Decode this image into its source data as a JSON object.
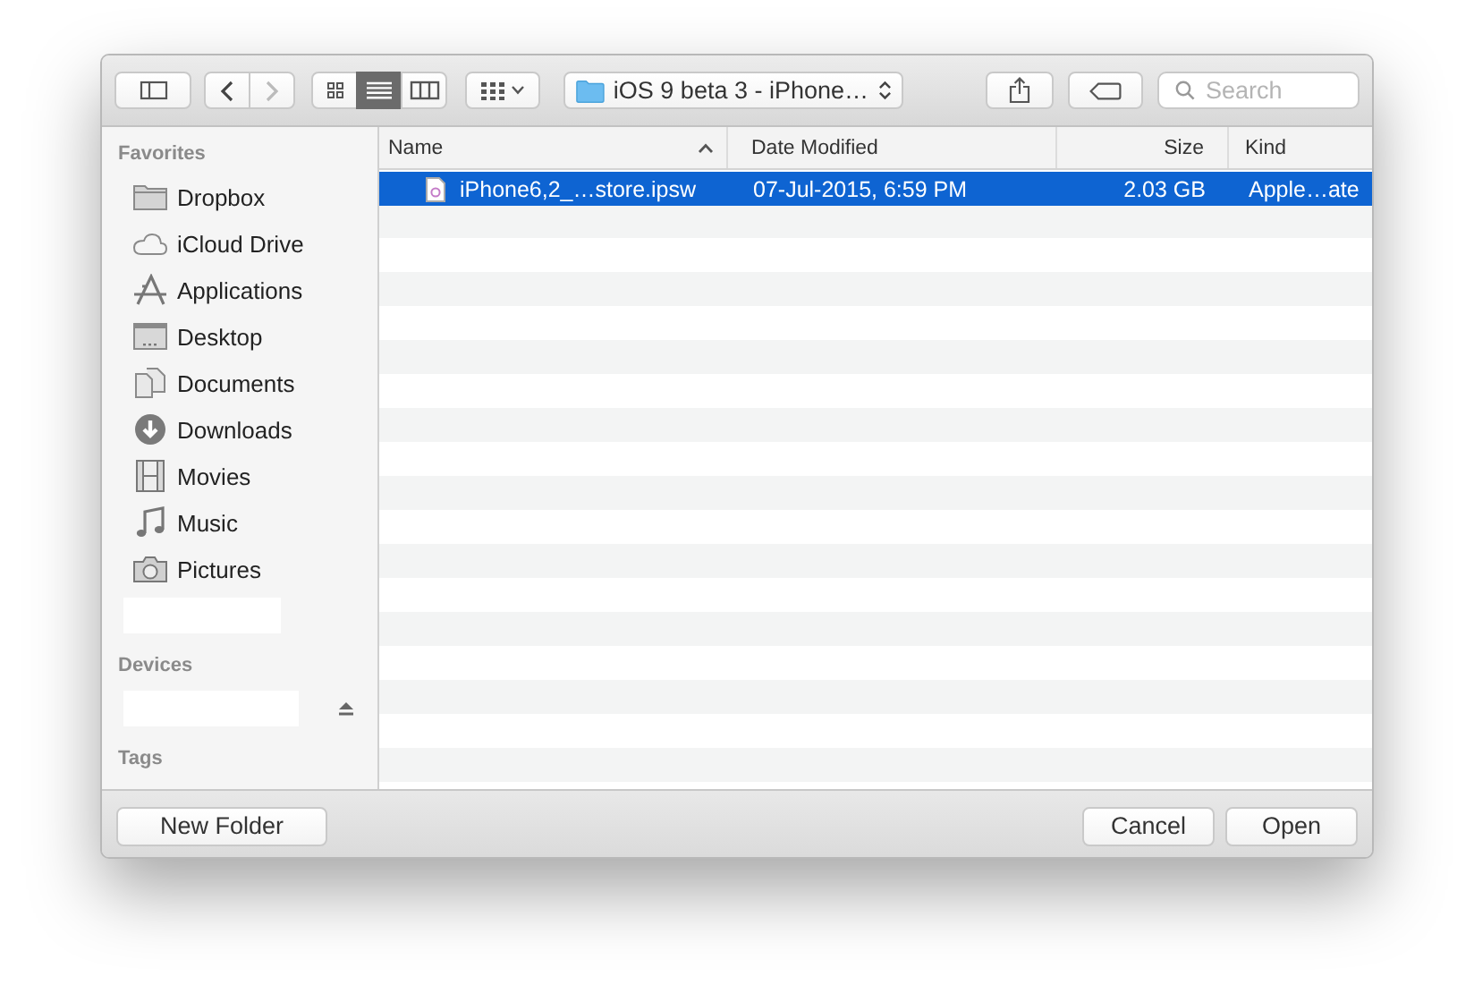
{
  "toolbar": {
    "view_modes": [
      {
        "selected": false
      },
      {
        "selected": true
      },
      {
        "selected": false
      }
    ],
    "location": "iOS 9 beta 3 - iPhone…",
    "search": {
      "placeholder": "Search"
    }
  },
  "sidebar": {
    "sections": [
      {
        "title": "Favorites",
        "items": [
          {
            "kind": "place",
            "label": "Dropbox"
          },
          {
            "kind": "place",
            "label": "iCloud Drive"
          },
          {
            "kind": "place",
            "label": "Applications"
          },
          {
            "kind": "place",
            "label": "Desktop"
          },
          {
            "kind": "place",
            "label": "Documents"
          },
          {
            "kind": "place",
            "label": "Downloads"
          },
          {
            "kind": "place",
            "label": "Movies"
          },
          {
            "kind": "place",
            "label": "Music"
          },
          {
            "kind": "place",
            "label": "Pictures"
          },
          {
            "kind": "blank",
            "eject": false
          }
        ]
      },
      {
        "title": "Devices",
        "items": [
          {
            "kind": "blank",
            "eject": true
          }
        ]
      },
      {
        "title": "Tags"
      }
    ]
  },
  "file_list": {
    "columns": [
      {
        "label": "Name",
        "sorted": true
      },
      {
        "label": "Date Modified",
        "sorted": false
      },
      {
        "label": "Size",
        "sorted": false
      },
      {
        "label": "Kind",
        "sorted": false
      }
    ],
    "rows": [
      {
        "name": "iPhone6,2_…store.ipsw",
        "date_modified": "07-Jul-2015, 6:59 PM",
        "size": "2.03 GB",
        "kind": "Apple…ate",
        "selected": true
      }
    ]
  },
  "buttons": {
    "new_folder": "New Folder",
    "cancel": "Cancel",
    "open": "Open"
  }
}
